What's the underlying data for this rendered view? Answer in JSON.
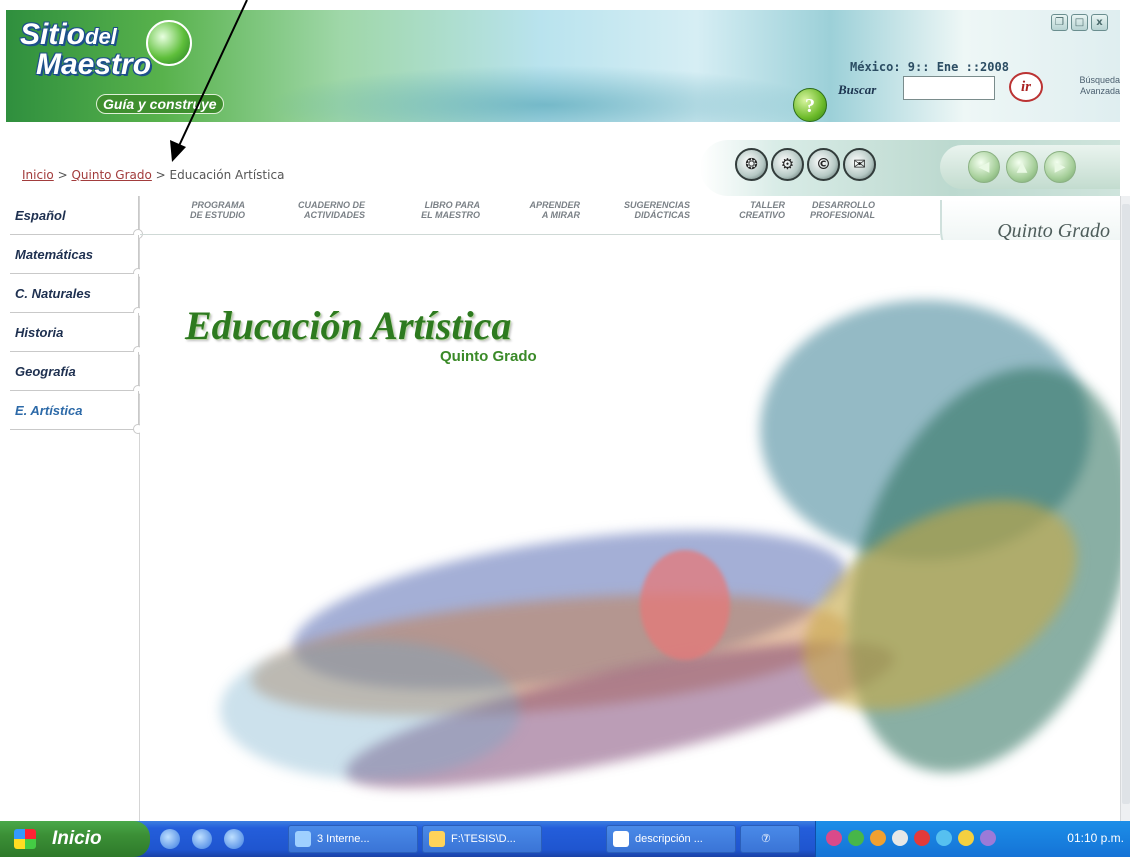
{
  "window": {
    "logo_line1": "Sitio",
    "logo_del": "del",
    "logo_line2": "Maestro",
    "logo_tagline": "Guía y construye",
    "controls": [
      "❐",
      "□",
      "x"
    ]
  },
  "header": {
    "help_label": "?",
    "date_text": "México: 9:: Ene ::2008",
    "search_label": "Buscar",
    "search_value": "",
    "go_label": "ir",
    "advanced_search_line1": "Búsqueda",
    "advanced_search_line2": "Avanzada"
  },
  "breadcrumb": {
    "home": "Inicio",
    "sep1": " > ",
    "grade": "Quinto Grado",
    "sep2": " > ",
    "current": "Educación Artística"
  },
  "tools": [
    "❂",
    "⚙",
    "©",
    "✉"
  ],
  "nav_arrows": [
    "◀",
    "▲",
    "▶"
  ],
  "sidebar": {
    "items": [
      {
        "label": "Español"
      },
      {
        "label": "Matemáticas"
      },
      {
        "label": "C. Naturales"
      },
      {
        "label": "Historia"
      },
      {
        "label": "Geografía"
      },
      {
        "label": "E. Artística"
      }
    ]
  },
  "sections": [
    {
      "label": "PROGRAMA\nDE ESTUDIO"
    },
    {
      "label": "CUADERNO DE\nACTIVIDADES"
    },
    {
      "label": "LIBRO PARA\nEL MAESTRO"
    },
    {
      "label": "APRENDER\nA MIRAR"
    },
    {
      "label": "SUGERENCIAS\nDIDÁCTICAS"
    },
    {
      "label": "TALLER\nCREATIVO"
    },
    {
      "label": "DESARROLLO\nPROFESIONAL"
    }
  ],
  "grade_tab": "Quinto Grado",
  "hero": {
    "title": "Educación Artística",
    "subtitle": "Quinto Grado"
  },
  "taskbar": {
    "start_label": "Inicio",
    "tasks": [
      {
        "label": "3 Interne..."
      },
      {
        "label": "F:\\TESIS\\D..."
      },
      {
        "label": "descripción ..."
      },
      {
        "label": "⑦"
      }
    ],
    "clock": "01:10 p.m."
  },
  "colors": {
    "accent_green": "#2d7a1f",
    "breadcrumb_link": "#a23c3c",
    "sidebar_text": "#1e3050",
    "taskbar_blue": "#245edb"
  }
}
